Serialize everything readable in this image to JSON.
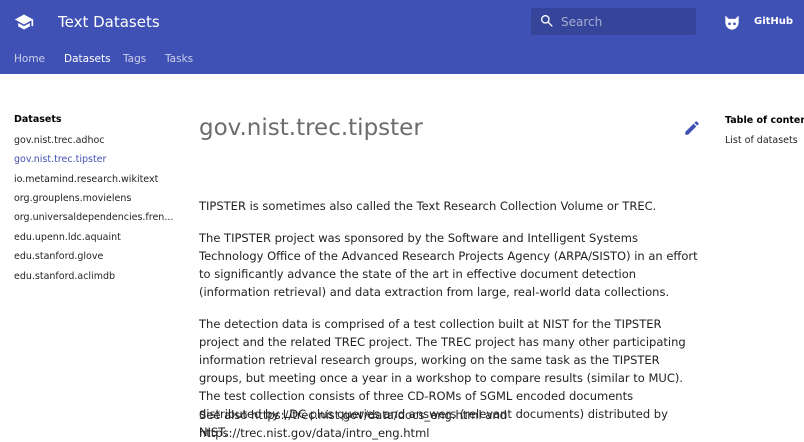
{
  "header": {
    "title": "Text Datasets",
    "search_placeholder": "Search",
    "repo_label": "GitHub",
    "color": "#4051b5"
  },
  "tabs": [
    {
      "label": "Home",
      "active": false
    },
    {
      "label": "Datasets",
      "active": true
    },
    {
      "label": "Tags",
      "active": false
    },
    {
      "label": "Tasks",
      "active": false
    }
  ],
  "sidebar": {
    "title": "Datasets",
    "items": [
      {
        "label": "gov.nist.trec.adhoc",
        "active": false
      },
      {
        "label": "gov.nist.trec.tipster",
        "active": true
      },
      {
        "label": "io.metamind.research.wikitext",
        "active": false
      },
      {
        "label": "org.grouplens.movielens",
        "active": false
      },
      {
        "label": "org.universaldependencies.fren...",
        "active": false
      },
      {
        "label": "edu.upenn.ldc.aquaint",
        "active": false
      },
      {
        "label": "edu.stanford.glove",
        "active": false
      },
      {
        "label": "edu.stanford.aclimdb",
        "active": false
      }
    ]
  },
  "content": {
    "title": "gov.nist.trec.tipster",
    "paragraphs": [
      "TIPSTER is sometimes also called the Text Research Collection Volume or TREC.",
      "The TIPSTER project was sponsored by the Software and Intelligent Systems Technology Office of the Advanced Research Projects Agency (ARPA/SISTO) in an effort to significantly advance the state of the art in effective document detection (information retrieval) and data extraction from large, real-world data collections.",
      "The detection data is comprised of a test collection built at NIST for the TIPSTER project and the related TREC project. The TREC project has many other participating information retrieval research groups, working on the same task as the TIPSTER groups, but meeting once a year in a workshop to compare results (similar to MUC). The test collection consists of three CD-ROMs of SGML encoded documents distributed by LDC plus queries and answers (relevant documents) distributed by NIST.",
      "See also https://trec.nist.gov/data/docs_eng.html and https://trec.nist.gov/data/intro_eng.html"
    ]
  },
  "toc": {
    "title": "Table of contents",
    "items": [
      "List of datasets"
    ]
  },
  "icons": {
    "logo": "graduation-cap-icon",
    "search": "search-icon",
    "repo": "github-icon",
    "edit": "pencil-icon"
  }
}
